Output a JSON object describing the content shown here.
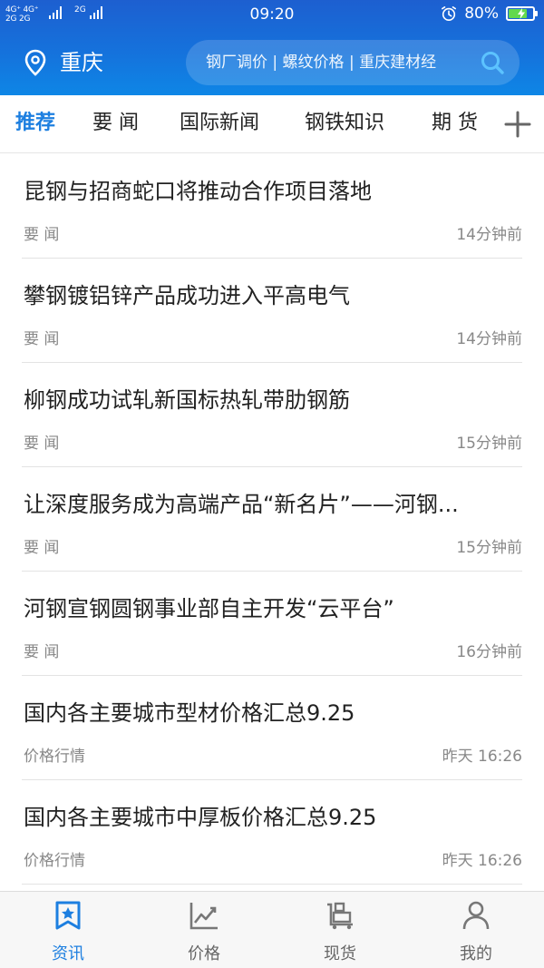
{
  "status_bar": {
    "network_left": "4G⁺ 4G⁺",
    "network_left2": "2G 2G",
    "network_right": "2G",
    "time": "09:20",
    "battery_percent": "80%",
    "battery_level": 0.8,
    "icons": [
      "alarm-icon",
      "battery-icon"
    ]
  },
  "header": {
    "city": "重庆",
    "search_placeholder": "钢厂调价 | 螺纹价格 | 重庆建材经",
    "colors": {
      "primary": "#1572dc",
      "accent": "#1d7fe0"
    }
  },
  "tabs": [
    {
      "label": "推荐",
      "active": true
    },
    {
      "label": "要 闻",
      "active": false
    },
    {
      "label": "国际新闻",
      "active": false
    },
    {
      "label": "钢铁知识",
      "active": false
    },
    {
      "label": "期 货",
      "active": false
    }
  ],
  "news": [
    {
      "title": "昆钢与招商蛇口将推动合作项目落地",
      "category": "要 闻",
      "time": "14分钟前"
    },
    {
      "title": "攀钢镀铝锌产品成功进入平高电气",
      "category": "要 闻",
      "time": "14分钟前"
    },
    {
      "title": "柳钢成功试轧新国标热轧带肋钢筋",
      "category": "要 闻",
      "time": "15分钟前"
    },
    {
      "title": "让深度服务成为高端产品“新名片”——河钢...",
      "category": "要 闻",
      "time": "15分钟前"
    },
    {
      "title": "河钢宣钢圆钢事业部自主开发“云平台”",
      "category": "要 闻",
      "time": "16分钟前"
    },
    {
      "title": "国内各主要城市型材价格汇总9.25",
      "category": "价格行情",
      "time": "昨天 16:26"
    },
    {
      "title": "国内各主要城市中厚板价格汇总9.25",
      "category": "价格行情",
      "time": "昨天 16:26"
    }
  ],
  "bottom_nav": [
    {
      "label": "资讯",
      "icon": "news-star-icon",
      "active": true
    },
    {
      "label": "价格",
      "icon": "chart-line-icon",
      "active": false
    },
    {
      "label": "现货",
      "icon": "cargo-cart-icon",
      "active": false
    },
    {
      "label": "我的",
      "icon": "user-icon",
      "active": false
    }
  ]
}
